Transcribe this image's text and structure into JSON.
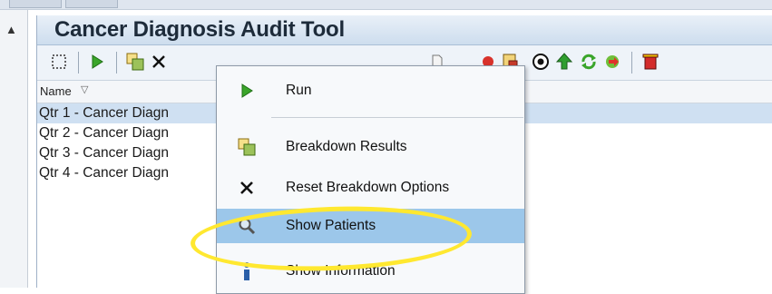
{
  "app": {
    "title": "Cancer Diagnosis Audit Tool"
  },
  "toolbar": {
    "buttons": [
      {
        "icon": "select-box-icon"
      },
      {
        "icon": "run-icon"
      },
      {
        "icon": "breakdown-icon"
      },
      {
        "icon": "reset-breakdown-icon"
      },
      {
        "icon": "document-icon"
      },
      {
        "icon": "red-chart-icon"
      },
      {
        "icon": "report-icon"
      },
      {
        "icon": "circle-badge-icon"
      },
      {
        "icon": "arrow-up-icon"
      },
      {
        "icon": "refresh-icon"
      },
      {
        "icon": "export-icon"
      },
      {
        "icon": "delete-icon"
      }
    ]
  },
  "list": {
    "column_header": "Name",
    "sort_glyph": "▽",
    "rows": [
      "Qtr 1 - Cancer Diagn",
      "Qtr 2 - Cancer Diagn",
      "Qtr 3 - Cancer Diagn",
      "Qtr 4 - Cancer Diagn"
    ]
  },
  "context_menu": {
    "items": [
      {
        "label": "Run",
        "icon": "run-icon"
      },
      {
        "label": "Breakdown Results",
        "icon": "breakdown-icon"
      },
      {
        "label": "Reset Breakdown Options",
        "icon": "close-icon"
      },
      {
        "label": "Show Patients",
        "icon": "magnifier-icon"
      },
      {
        "label": "Show Information",
        "icon": "info-icon"
      }
    ],
    "highlighted": "Show Patients"
  },
  "colors": {
    "highlight": "#9cc7ea",
    "annotation_ring": "#ffe830",
    "run_green": "#3aa52a"
  }
}
